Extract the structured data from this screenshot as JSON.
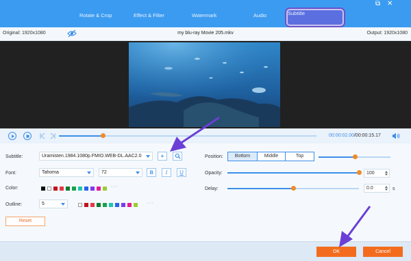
{
  "tabs": [
    {
      "label": "Rotate & Crop"
    },
    {
      "label": "Effect & Filter"
    },
    {
      "label": "Watermark"
    },
    {
      "label": "Audio"
    },
    {
      "label": "Subtitle",
      "active": true
    }
  ],
  "window": {
    "restore": "⧉",
    "close": "✕"
  },
  "info": {
    "original": "Original: 1920x1080",
    "filename": "my blu-ray Movie 205.mkv",
    "output": "Output: 1920x1080"
  },
  "playback": {
    "current_time": "00:00:02.00",
    "total_time": "/00:00:15.17",
    "progress_fraction": 0.17
  },
  "subtitle": {
    "label": "Subtitle:",
    "value": "Uramisten.1984.1080p.FMIO.WEB-DL.AAC2.0",
    "add_label": "+"
  },
  "font": {
    "label": "Font:",
    "family": "Tahoma",
    "size": "72",
    "bold": "B",
    "italic": "I",
    "underline": "U"
  },
  "color": {
    "label": "Color:",
    "swatches": [
      "#111111",
      "#ffffff",
      "#c1121f",
      "#e63946",
      "#0b7a34",
      "#16a34a",
      "#1ec7b0",
      "#2563eb",
      "#7c3aed",
      "#e11d8f",
      "#9ccc35"
    ],
    "more": "···"
  },
  "outline": {
    "label": "Outline:",
    "value": "5",
    "swatches": [
      "#ffffff",
      "#c1121f",
      "#e63946",
      "#0b7a34",
      "#16a34a",
      "#1ec7b0",
      "#2563eb",
      "#7c3aed",
      "#e11d8f",
      "#9ccc35"
    ],
    "more": "···"
  },
  "position": {
    "label": "Position:",
    "options": [
      "Bottom",
      "Middle",
      "Top"
    ],
    "selected": "Bottom",
    "slider_fraction": 0.5
  },
  "opacity": {
    "label": "Opacity:",
    "value": "100",
    "slider_fraction": 1.0
  },
  "delay": {
    "label": "Delay:",
    "value": "0.0",
    "unit": "s",
    "slider_fraction": 0.5
  },
  "reset_label": "Reset",
  "ok_label": "OK",
  "cancel_label": "Cancel",
  "colors": {
    "accent": "#3b8ee8",
    "tabbar": "#3b9bf0",
    "orange": "#f36c1e",
    "annotation": "#6b3fd6"
  }
}
